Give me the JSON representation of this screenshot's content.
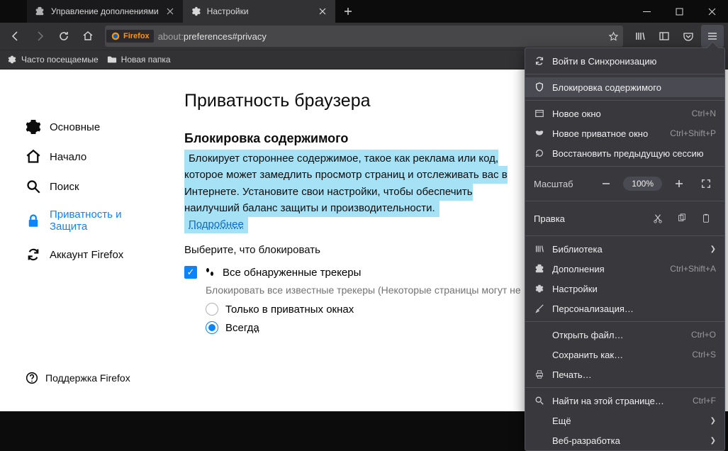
{
  "tabs": [
    {
      "label": "Управление дополнениями",
      "active": false
    },
    {
      "label": "Настройки",
      "active": true
    }
  ],
  "urlbar": {
    "identity": "Firefox",
    "url_prefix": "about:",
    "url_rest": "preferences#privacy"
  },
  "bookmarks": {
    "most_visited": "Часто посещаемые",
    "new_folder": "Новая папка"
  },
  "sidebar": {
    "general": "Основные",
    "home": "Начало",
    "search": "Поиск",
    "privacy_line1": "Приватность и",
    "privacy_line2": "Защита",
    "account": "Аккаунт Firefox",
    "support": "Поддержка Firefox"
  },
  "prefs": {
    "heading": "Приватность браузера",
    "section": "Блокировка содержимого",
    "desc": "Блокирует стороннее содержимое, такое как реклама или код, которое может замедлить просмотр страниц и отслеживать вас в Интернете. Установите свои настройки, чтобы обеспечить наилучший баланс защиты и производительности.",
    "learn_more": "Подробнее",
    "choose": "Выберите, что блокировать",
    "all_trackers": "Все обнаруженные трекеры",
    "all_trackers_sub": "Блокировать все известные трекеры (Некоторые страницы могут не",
    "only_private": "Только в приватных окнах",
    "always_prefix": "Всег",
    "always_underline": "да"
  },
  "menu": {
    "signin": "Войти в Синхронизацию",
    "content_blocking": "Блокировка содержимого",
    "new_window": {
      "label": "Новое окно",
      "shortcut": "Ctrl+N"
    },
    "new_private": {
      "label": "Новое приватное окно",
      "shortcut": "Ctrl+Shift+P"
    },
    "restore": "Восстановить предыдущую сессию",
    "zoom_label": "Масштаб",
    "zoom_value": "100%",
    "edit_label": "Правка",
    "library": "Библиотека",
    "addons": {
      "label": "Дополнения",
      "shortcut": "Ctrl+Shift+A"
    },
    "settings": "Настройки",
    "customize": "Персонализация…",
    "open_file": {
      "label": "Открыть файл…",
      "shortcut": "Ctrl+O"
    },
    "save_as": {
      "label": "Сохранить как…",
      "shortcut": "Ctrl+S"
    },
    "print": "Печать…",
    "find": {
      "label": "Найти на этой странице…",
      "shortcut": "Ctrl+F"
    },
    "more": "Ещё",
    "webdev": "Веб-разработка"
  }
}
